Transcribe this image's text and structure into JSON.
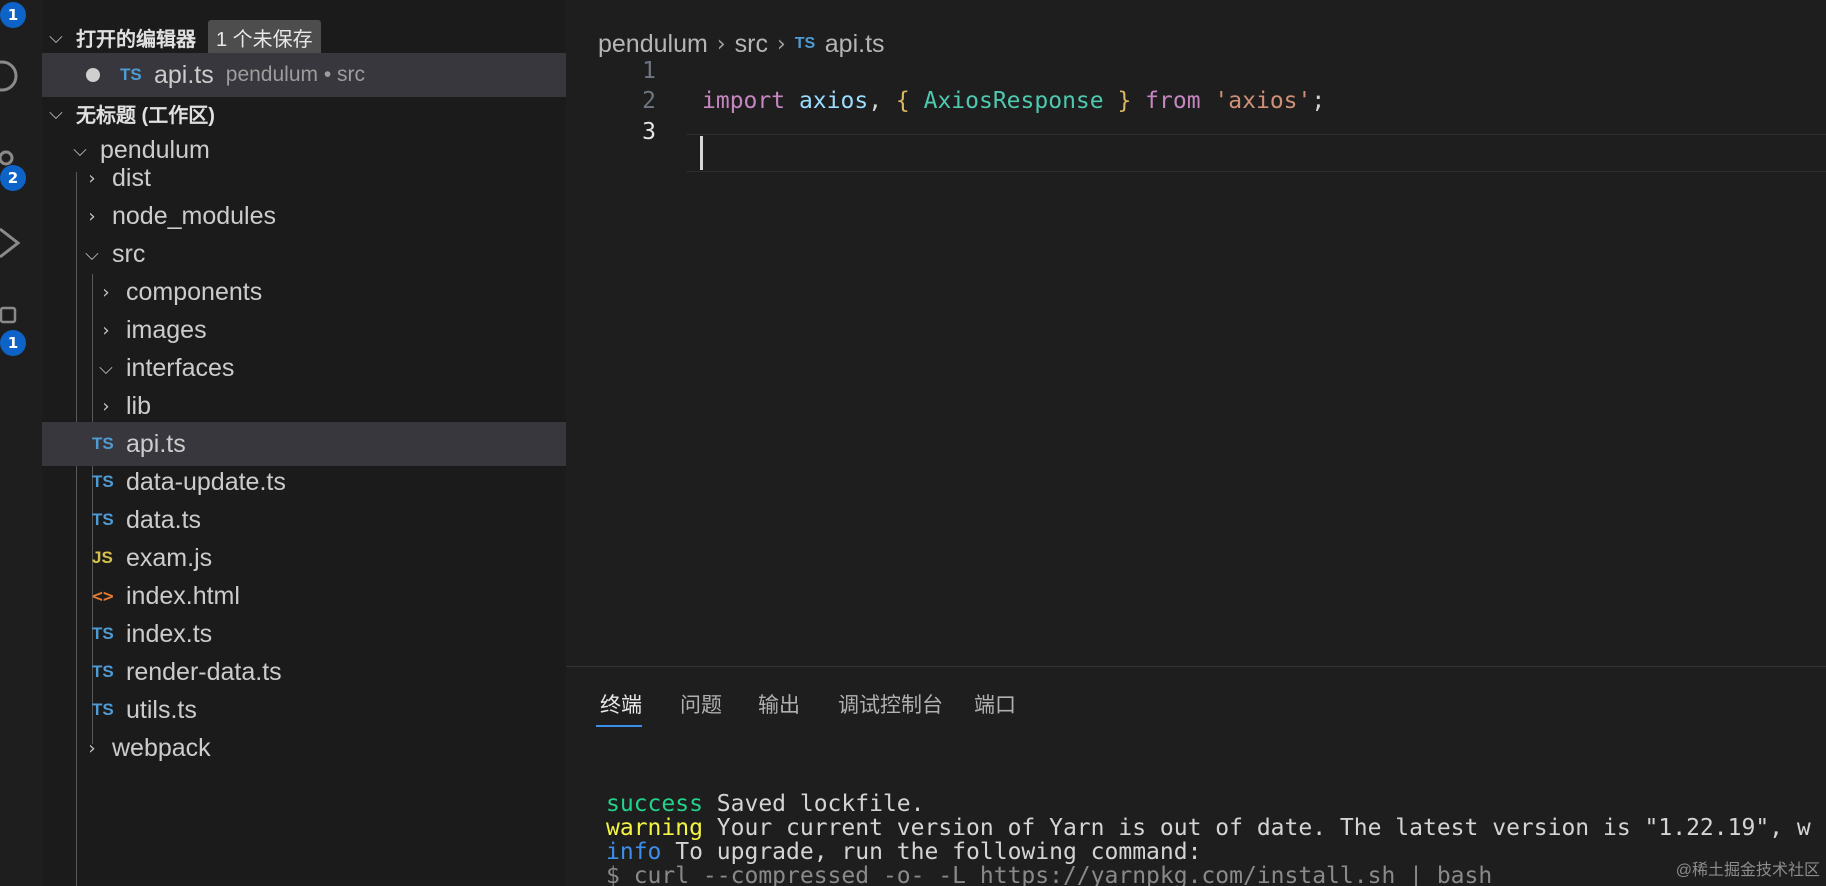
{
  "activity_bar": {
    "badges": [
      "1",
      "2",
      "1"
    ],
    "icons": [
      "search-icon",
      "source-control-icon",
      "run-debug-icon",
      "extensions-icon"
    ]
  },
  "sidebar": {
    "open_editors": {
      "title": "打开的编辑器",
      "unsaved_badge": "1 个未保存",
      "items": [
        {
          "icon": "TS",
          "name": "api.ts",
          "description": "pendulum • src"
        }
      ]
    },
    "workspace": {
      "title": "无标题 (工作区)",
      "root": "pendulum",
      "tree": {
        "dist": "dist",
        "node_modules": "node_modules",
        "src": "src",
        "components": "components",
        "images": "images",
        "interfaces": "interfaces",
        "lib": "lib",
        "files": [
          {
            "icon": "TS",
            "name": "api.ts"
          },
          {
            "icon": "TS",
            "name": "data-update.ts"
          },
          {
            "icon": "TS",
            "name": "data.ts"
          },
          {
            "icon": "JS",
            "name": "exam.js"
          },
          {
            "icon": "<>",
            "name": "index.html"
          },
          {
            "icon": "TS",
            "name": "index.ts"
          },
          {
            "icon": "TS",
            "name": "render-data.ts"
          },
          {
            "icon": "TS",
            "name": "utils.ts"
          }
        ],
        "webpack": "webpack"
      }
    }
  },
  "editor": {
    "breadcrumb": [
      "pendulum",
      "src",
      "api.ts"
    ],
    "breadcrumb_file_icon": "TS",
    "line_numbers": [
      "1",
      "2",
      "3"
    ],
    "code_line2": {
      "import": "import",
      "axios": " axios",
      "comma": ",",
      "lbrace": " {",
      "response": " AxiosResponse",
      "rbrace": " }",
      "from": " from",
      "module": " 'axios'",
      "semi": ";"
    }
  },
  "panel": {
    "tabs": [
      "终端",
      "问题",
      "输出",
      "调试控制台",
      "端口"
    ],
    "terminal": [
      {
        "tag": "success",
        "text": " Saved lockfile."
      },
      {
        "tag": "warning",
        "text": " Your current version of Yarn is out of date. The latest version is \"1.22.19\", w"
      },
      {
        "tag": "info",
        "text": " To upgrade, run the following command:"
      },
      {
        "tag": "",
        "text": "$ curl --compressed -o- -L https://yarnpkg.com/install.sh | bash"
      }
    ]
  },
  "watermark": "@稀土掘金技术社区",
  "colors": {
    "accent": "#3b8eea",
    "badge": "#0e63c8",
    "ts_icon": "#4f9bd4",
    "js_icon": "#d6c24a",
    "html_icon": "#e37933",
    "keyword": "#c586c0",
    "string": "#ce9178",
    "type": "#4ec9b0",
    "variable": "#9cdcfe"
  }
}
